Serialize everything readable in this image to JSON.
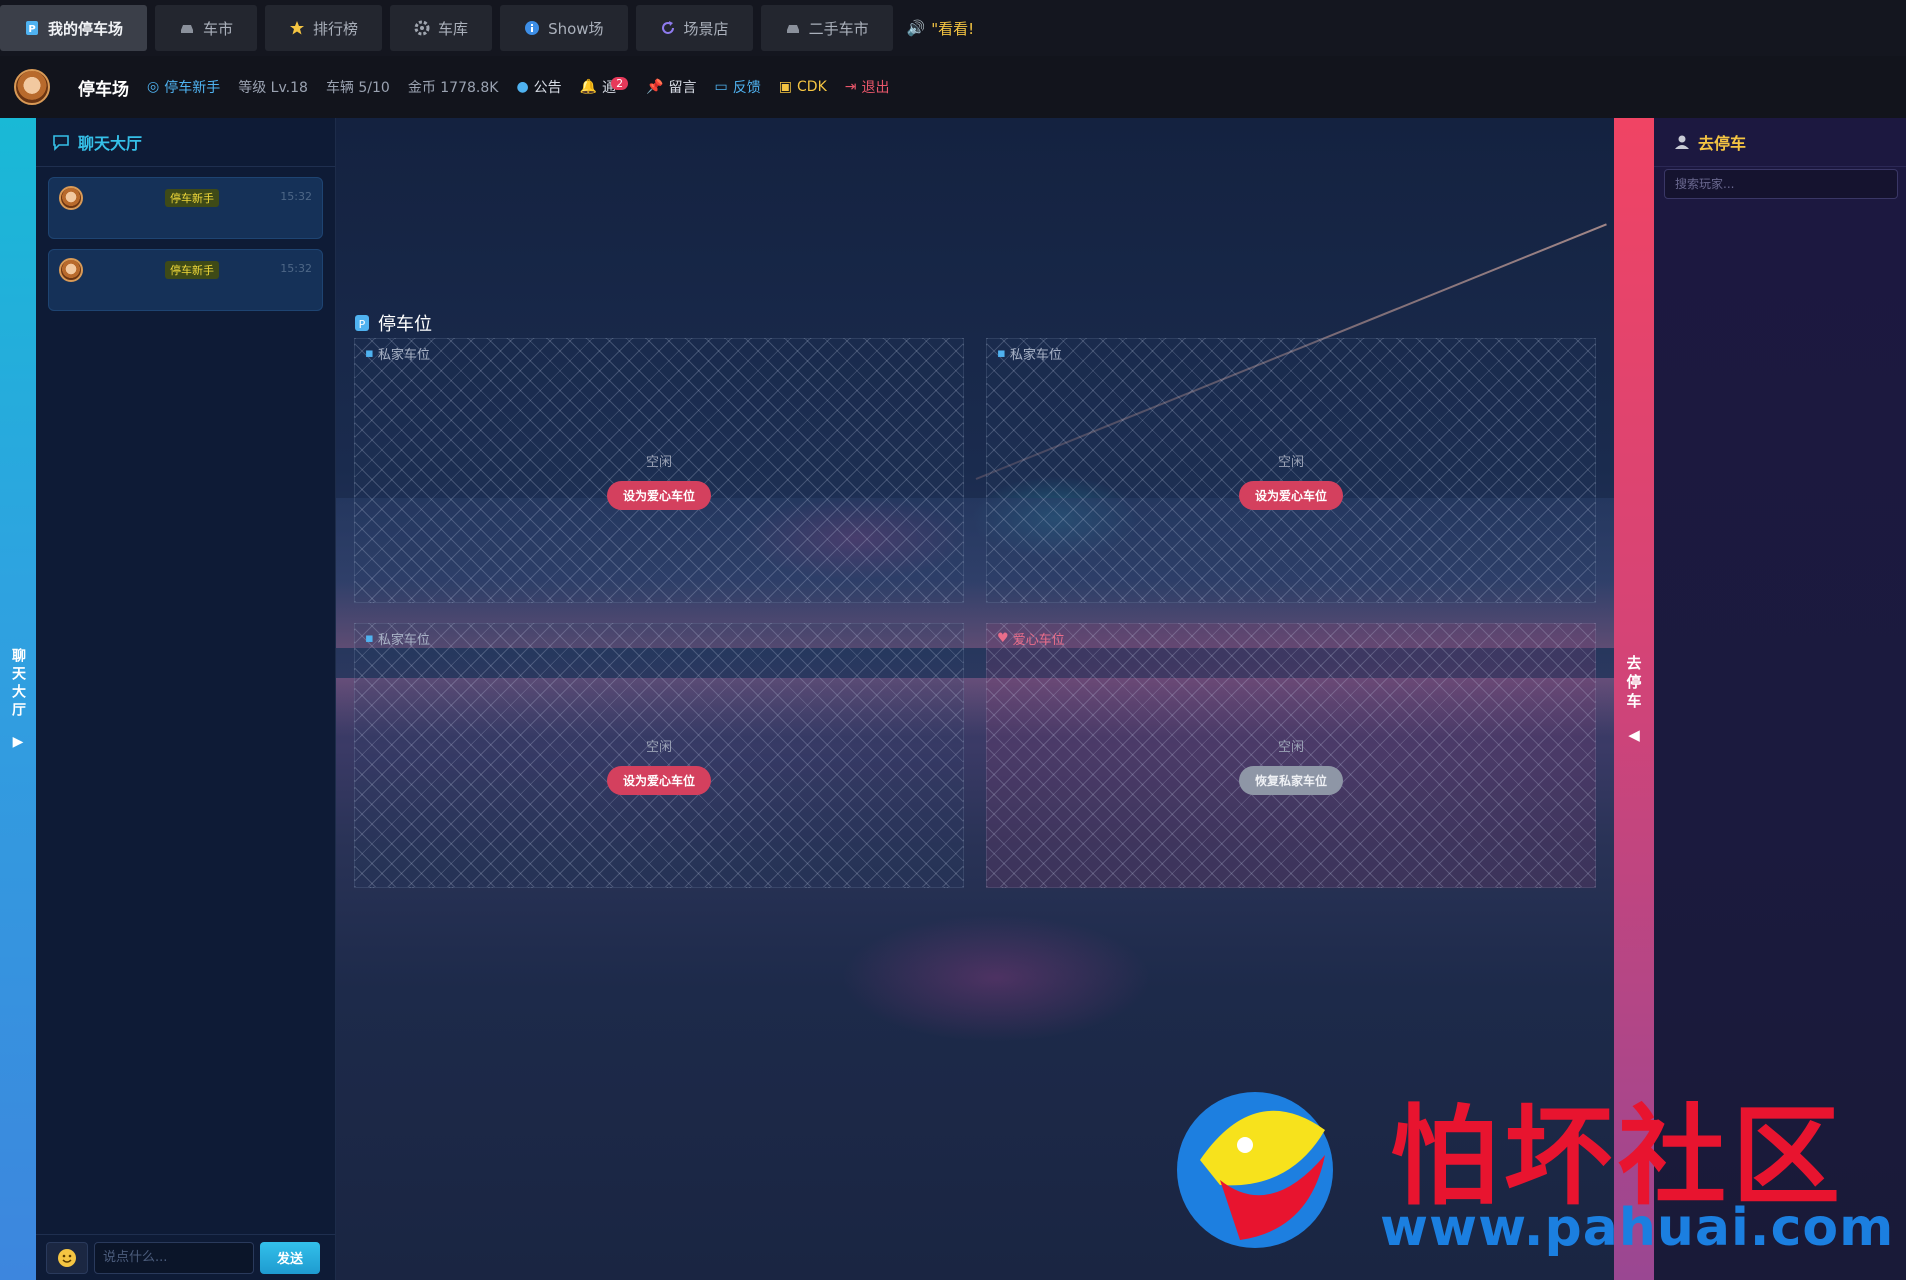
{
  "nav": {
    "tabs": [
      {
        "label": "我的停车场",
        "icon": "parking-icon",
        "active": true
      },
      {
        "label": "车市",
        "icon": "car-icon",
        "active": false
      },
      {
        "label": "排行榜",
        "icon": "star-icon",
        "active": false
      },
      {
        "label": "车库",
        "icon": "gear-icon",
        "active": false
      },
      {
        "label": "Show场",
        "icon": "info-icon",
        "active": false
      },
      {
        "label": "场景店",
        "icon": "refresh-icon",
        "active": false
      },
      {
        "label": "二手车市",
        "icon": "car-icon",
        "active": false
      }
    ],
    "notice": "\"看看!"
  },
  "info": {
    "lot_name": "停车场",
    "rank_title": "停车新手",
    "level": "等级 Lv.18",
    "cars": "车辆 5/10",
    "coins": "金币 1778.8K",
    "announcement": "公告",
    "notify": "通",
    "notify_count": "2",
    "message_board": "留言",
    "feedback": "反馈",
    "cdk": "CDK",
    "logout": "退出"
  },
  "left_strip": {
    "label": "聊天大厅",
    "arrow": "▶"
  },
  "chat": {
    "title": "聊天大厅",
    "messages": [
      {
        "tag": "停车新手",
        "time": "15:32"
      },
      {
        "tag": "停车新手",
        "time": "15:32"
      }
    ],
    "input_placeholder": "说点什么...",
    "send_label": "发送"
  },
  "parking": {
    "title": "停车位",
    "slots": [
      {
        "type": "私家车位",
        "status": "空闲",
        "button": "设为爱心车位",
        "love": false
      },
      {
        "type": "私家车位",
        "status": "空闲",
        "button": "设为爱心车位",
        "love": false
      },
      {
        "type": "私家车位",
        "status": "空闲",
        "button": "设为爱心车位",
        "love": false
      },
      {
        "type": "爱心车位",
        "status": "空闲",
        "button": "恢复私家车位",
        "love": true
      }
    ]
  },
  "right_strip": {
    "label": "去停车",
    "arrow": "◀"
  },
  "right_panel": {
    "title": "去停车",
    "search_placeholder": "搜索玩家..."
  },
  "watermark": {
    "cn": "怕坏社区",
    "url": "www.pahuai.com"
  },
  "colors": {
    "accent_cyan": "#35c0e8",
    "accent_pink": "#d4405e",
    "accent_yellow": "#f5c542"
  }
}
